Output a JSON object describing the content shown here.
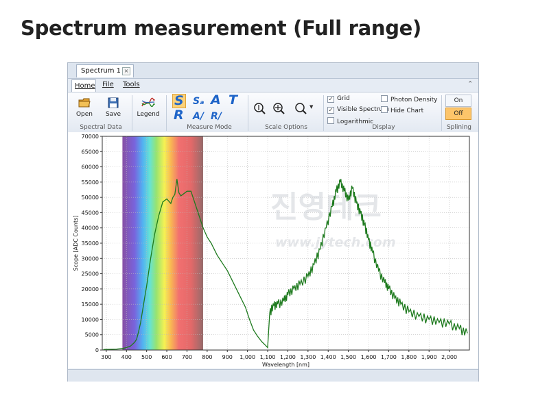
{
  "page": {
    "title": "Spectrum measurement (Full range)"
  },
  "window": {
    "doc_tab": "Spectrum 1",
    "menu": [
      "Home",
      "File",
      "Tools"
    ]
  },
  "ribbon": {
    "spectral_data": {
      "label": "Spectral Data",
      "open": "Open",
      "save": "Save"
    },
    "legend": {
      "label": "Legend"
    },
    "measure_mode": {
      "label": "Measure Mode",
      "buttons": [
        "S",
        "Sₐ",
        "A",
        "T",
        "R",
        "A/",
        "R/"
      ],
      "selected": "S"
    },
    "scale_options": {
      "label": "Scale Options"
    },
    "display": {
      "label": "Display",
      "grid": "Grid",
      "grid_checked": true,
      "visible_spectrum": "Visible Spectrum",
      "visible_spectrum_checked": true,
      "logarithmic": "Logarithmic",
      "logarithmic_checked": false,
      "photon_density": "Photon Density",
      "photon_density_checked": false,
      "hide_chart": "Hide Chart",
      "hide_chart_checked": false
    },
    "splining": {
      "label": "Splining",
      "on": "On",
      "off": "Off",
      "selected": "Off"
    }
  },
  "watermark": {
    "text1": "진영테크",
    "text2": "www.jytech.com"
  },
  "chart_data": {
    "type": "line",
    "xlabel": "Wavelength [nm]",
    "ylabel": "Scope [ADC Counts]",
    "xlim": [
      280,
      2100
    ],
    "ylim": [
      0,
      70000
    ],
    "x_ticks": [
      300,
      400,
      500,
      600,
      700,
      800,
      900,
      1000,
      1100,
      1200,
      1300,
      1400,
      1500,
      1600,
      1700,
      1800,
      1900,
      2000
    ],
    "x_tick_labels": [
      "300",
      "400",
      "500",
      "600",
      "700",
      "800",
      "900",
      "1,000",
      "1,100",
      "1,200",
      "1,300",
      "1,400",
      "1,500",
      "1,600",
      "1,700",
      "1,800",
      "1,900",
      "2,000"
    ],
    "y_ticks": [
      0,
      5000,
      10000,
      15000,
      20000,
      25000,
      30000,
      35000,
      40000,
      45000,
      50000,
      55000,
      60000,
      65000,
      70000
    ],
    "grid": true,
    "visible_spectrum_band": [
      380,
      780
    ],
    "line_color": "#1e7a1e",
    "x": [
      285,
      350,
      380,
      400,
      420,
      440,
      450,
      460,
      470,
      480,
      490,
      500,
      520,
      540,
      560,
      580,
      600,
      620,
      630,
      640,
      650,
      660,
      670,
      680,
      700,
      720,
      740,
      760,
      780,
      800,
      820,
      850,
      880,
      900,
      930,
      960,
      990,
      1010,
      1030,
      1050,
      1070,
      1090,
      1100,
      1110,
      1130,
      1150,
      1180,
      1200,
      1230,
      1260,
      1300,
      1330,
      1360,
      1390,
      1420,
      1440,
      1460,
      1480,
      1500,
      1520,
      1540,
      1560,
      1580,
      1600,
      1620,
      1650,
      1680,
      1700,
      1730,
      1760,
      1800,
      1850,
      1900,
      1950,
      2000,
      2050,
      2090
    ],
    "y": [
      200,
      300,
      500,
      800,
      1300,
      2500,
      3500,
      6000,
      9000,
      13000,
      17000,
      21000,
      30000,
      38000,
      44000,
      48500,
      49500,
      48000,
      50000,
      51000,
      56000,
      51500,
      50500,
      51000,
      52000,
      52000,
      48000,
      44000,
      40000,
      37000,
      35000,
      31000,
      28000,
      26000,
      22000,
      18000,
      14000,
      10000,
      6500,
      4500,
      2800,
      1500,
      800,
      12000,
      14500,
      15000,
      16000,
      18000,
      20000,
      21500,
      24000,
      28000,
      33000,
      40000,
      47000,
      52000,
      55000,
      52000,
      49000,
      53000,
      48000,
      45000,
      41000,
      36000,
      32000,
      26000,
      22000,
      20000,
      17000,
      15000,
      12500,
      11000,
      10000,
      9000,
      8500,
      7000,
      5500
    ]
  }
}
